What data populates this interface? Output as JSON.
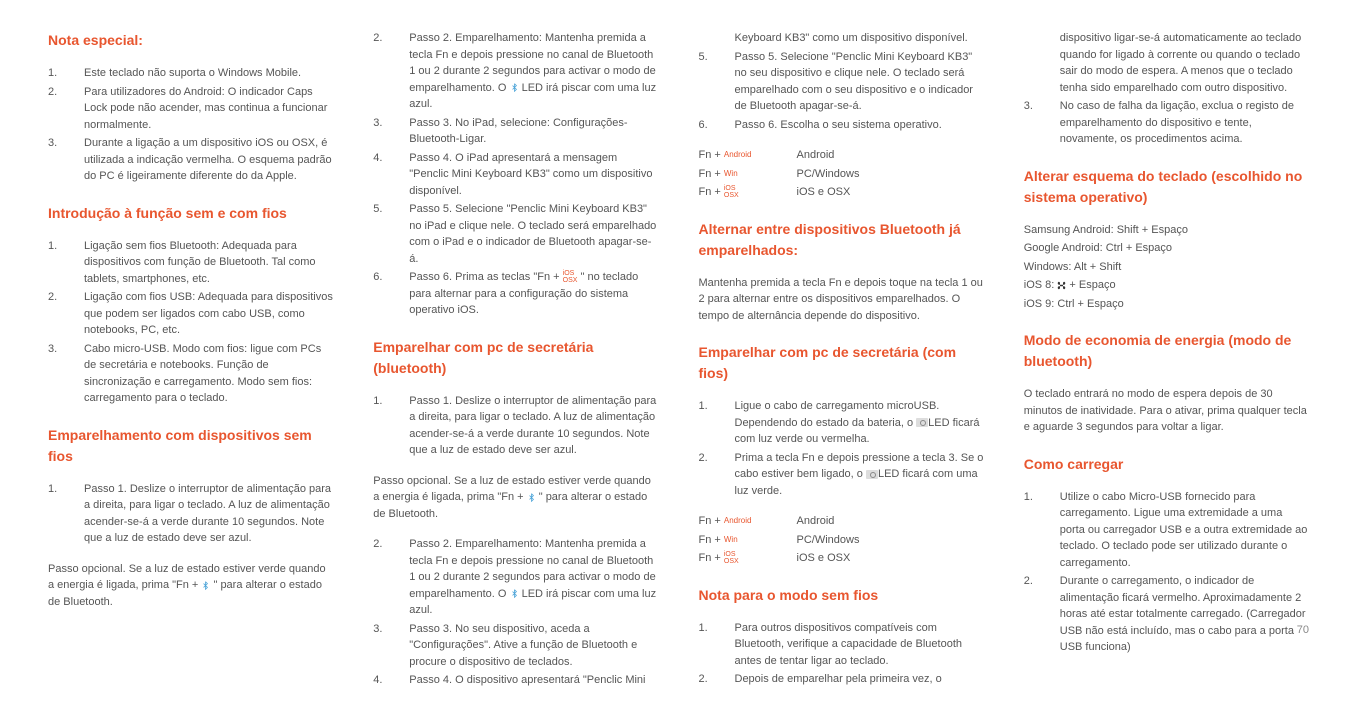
{
  "page_number": "70",
  "col1": {
    "h1": "Nota especial:",
    "list1": [
      "Este teclado não suporta o Windows Mobile.",
      "Para utilizadores do Android: O indicador Caps Lock pode não acender, mas continua a funcionar normalmente.",
      "Durante a ligação a um dispositivo iOS ou OSX, é utilizada a indicação vermelha. O esquema padrão do PC é ligeiramente diferente do da Apple."
    ],
    "h2": "Introdução à função sem e com fios",
    "list2": [
      "Ligação sem fios Bluetooth: Adequada para dispositivos com função de Bluetooth. Tal como tablets, smartphones, etc.",
      "Ligação com fios USB: Adequada para dispositivos que podem ser ligados com cabo USB, como notebooks, PC, etc.",
      "Cabo micro-USB. Modo com fios: ligue com PCs de secretária e notebooks. Função de sincronização e carregamento. Modo sem fios: carregamento para o teclado."
    ],
    "h3": "Emparelhamento com disposi­tivos sem fios",
    "list3": [
      "Passo 1. Deslize o interruptor de alimentação para a direita, para ligar o teclado. A luz de alimentação acender-se-á a verde durante 10 segundos. Note que a luz de estado deve ser azul."
    ],
    "p1a": "Passo opcional. Se a luz de estado estiver verde quando a energia é ligada, prima \"Fn + ",
    "p1b": " \" para alterar o estado de Bluetooth."
  },
  "col2": {
    "list1": [
      {
        "n": "2.",
        "t_a": "Passo 2. Emparelhamento: Mantenha premida a tecla Fn e depois pressione no canal de Bluetooth 1 ou 2 durante 2 segundos para activar o modo de emparelhamento. O ",
        "t_b": " LED irá piscar com uma luz azul."
      },
      {
        "n": "3.",
        "t": "Passo 3. No iPad, selecione: Configurações-Bluetooth-Ligar."
      },
      {
        "n": "4.",
        "t": "Passo 4. O iPad apresentará a mensagem \"Penclic Mini Keyboard KB3\" como um dispositivo disponível."
      },
      {
        "n": "5.",
        "t": "Passo 5. Selecione \"Penclic Mini Keyboard KB3\" no iPad e clique nele. O teclado será emparelhado com o iPad e o indicador de Bluetooth apagar-se-á."
      },
      {
        "n": "6.",
        "t_a": "Passo 6. Prima as teclas \"Fn + ",
        "t_b": " \" no teclado para alternar para a configuração do sistema operativo iOS."
      }
    ],
    "h1": "Emparelhar com pc de secretária (bluetooth)",
    "list2": [
      "Passo 1. Deslize o interruptor de alimentação para a direita, para ligar o teclado. A luz de alimentação acender-se-á a verde durante 10 segundos. Note que a luz de estado deve ser azul."
    ],
    "p1a": "Passo opcional. Se a luz de estado estiver verde quando a energia é ligada, prima \"Fn + ",
    "p1b": " \" para alterar o estado de Bluetooth.",
    "list3": [
      {
        "n": "2.",
        "t_a": "Passo 2. Emparelhamento: Mantenha premida a tecla Fn e depois pressione no canal de Bluetooth 1 ou 2 durante 2 segundos para activar o modo de emparelhamento. O ",
        "t_b": " LED irá piscar com uma luz azul."
      },
      {
        "n": "3.",
        "t": "Passo 3. No seu dispositivo, aceda a \"Configurações\". Ative a função de Bluetooth e procure o dispositivo de teclados."
      },
      {
        "n": "4.",
        "t": "Passo 4. O dispositivo apresentará \"Penclic Mini"
      }
    ]
  },
  "col3": {
    "list1": [
      {
        "n": "",
        "t": "Keyboard KB3\" como um dispositivo disponível."
      },
      {
        "n": "5.",
        "t": "Passo 5. Selecione \"Penclic Mini Keyboard KB3\" no seu dispositivo e clique nele. O teclado será emparelhado com o seu dispositivo e o indicador de Bluetooth apagar-se-á."
      },
      {
        "n": "6.",
        "t": "Passo 6. Escolha o seu sistema operativo."
      }
    ],
    "fn1": [
      {
        "k": "Fn + ",
        "tag": "Android",
        "v": "Android"
      },
      {
        "k": "Fn + ",
        "tag": "Win",
        "v": "PC/Windows"
      },
      {
        "k": "Fn + ",
        "tag": "iOS\nOSX",
        "v": "iOS e OSX"
      }
    ],
    "h1": "Alternar entre dispositivos Bluetooth já emparelhados:",
    "p1": "Mantenha premida a tecla Fn e depois toque na tecla 1 ou 2 para alternar entre os dispositivos emparelhados. O tempo de alternância depende do dispositivo.",
    "h2": "Emparelhar com pc de secretária (com fios)",
    "list2": [
      {
        "n": "1.",
        "t_a": "Ligue o cabo de carregamento microUSB. Dependendo do estado da bateria, o ",
        "t_b": "LED ficará com luz verde ou vermelha."
      },
      {
        "n": "2.",
        "t_a": "Prima a tecla Fn e depois pressione a tecla 3. Se o cabo estiver bem ligado, o ",
        "t_b": "LED ficará com uma luz verde."
      }
    ],
    "fn2": [
      {
        "k": "Fn + ",
        "tag": "Android",
        "v": "Android"
      },
      {
        "k": "Fn + ",
        "tag": "Win",
        "v": "PC/Windows"
      },
      {
        "k": "Fn + ",
        "tag": "iOS\nOSX",
        "v": "iOS e OSX"
      }
    ],
    "h3": "Nota para o modo sem fios",
    "list3": [
      "Para outros dispositivos compatíveis com Bluetooth, verifique a capacidade de Bluetooth antes de tentar ligar ao teclado.",
      "Depois de emparelhar pela primeira vez, o"
    ]
  },
  "col4": {
    "list1": [
      {
        "n": "",
        "t": "dispositivo ligar-se-á automaticamente ao teclado quando for ligado à corrente ou quando o teclado sair do modo de espera. A menos que o teclado tenha sido emparelhado com outro dispositivo."
      },
      {
        "n": "3.",
        "t": "No caso de falha da ligação, exclua o registo de emparelhamento do dispositivo e tente, novamente, os procedimentos acima."
      }
    ],
    "h1": "Alterar esquema do teclado (escolhido no sistema operativo)",
    "lines": [
      "Samsung Android: Shift + Espaço",
      "Google Android: Ctrl + Espaço",
      "Windows: Alt + Shift"
    ],
    "ios8a": "iOS 8: ",
    "ios8b": " + Espaço",
    "ios9": "iOS 9: Ctrl + Espaço",
    "h2": "Modo de economia de energia (modo de bluetooth)",
    "p1": "O teclado entrará no modo de espera depois de 30 minutos de inatividade. Para o ativar, prima qualquer tecla e aguarde 3 segundos para voltar a ligar.",
    "h3": "Como carregar",
    "list3": [
      "Utilize o cabo Micro-USB fornecido para carregamento. Ligue uma extremidade a uma porta ou carregador USB e a outra extremidade ao teclado. O teclado pode ser utilizado durante o carregamento.",
      "Durante o carregamento, o indicador de alimentação ficará vermelho. Aproximadamente 2 horas até estar totalmente carregado. (Carregador USB não está incluído, mas o cabo para a porta USB funciona)"
    ]
  }
}
